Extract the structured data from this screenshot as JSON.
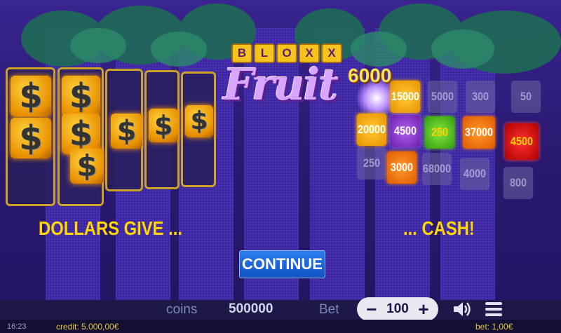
{
  "logo": {
    "top": [
      "B",
      "L",
      "O",
      "X",
      "X"
    ],
    "main": "Fruit"
  },
  "captions": {
    "left": "DOLLARS GIVE ...",
    "right": "... CASH!"
  },
  "continue_label": "CONTINUE",
  "win_amount": "6000",
  "cash_values": {
    "row1": [
      "15000",
      "5000",
      "300",
      "50"
    ],
    "row2": [
      "20000",
      "4500",
      "250",
      "37000",
      "4500"
    ],
    "row3": [
      "250",
      "3000",
      "68000",
      "4000",
      "800"
    ]
  },
  "footer": {
    "coins_label": "coins",
    "coins_value": "500000",
    "bet_label": "Bet",
    "bet_value": "100",
    "minus": "−",
    "plus": "+"
  },
  "status": {
    "time": "16:23",
    "credit": "credit: 5.000,00€",
    "bet": "bet: 1,00€"
  },
  "icons": [
    "sound-icon",
    "menu-icon",
    "dollar-icon"
  ]
}
